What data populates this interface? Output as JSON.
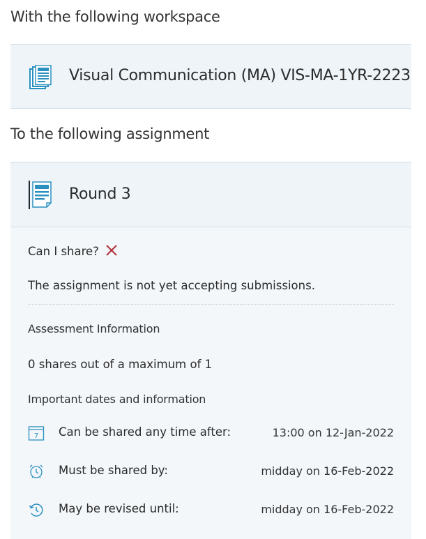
{
  "workspace": {
    "heading": "With the following workspace",
    "name": "Visual Communication (MA) VIS-MA-1YR-2223",
    "icon": "documents-icon"
  },
  "assignment": {
    "heading": "To the following assignment",
    "name": "Round 3",
    "icon": "document-icon"
  },
  "details": {
    "can_share_label": "Can I share?",
    "can_share_icon": "cross-icon",
    "status_message": "The assignment is not yet accepting submissions.",
    "assessment_heading": "Assessment Information",
    "shares_text": "0 shares out of a maximum of 1",
    "dates_heading": "Important dates and information",
    "dates": [
      {
        "icon": "calendar-icon",
        "label": "Can be shared any time after:",
        "value": "13:00 on 12-Jan-2022"
      },
      {
        "icon": "alarm-clock-icon",
        "label": "Must be shared by:",
        "value": "midday on 16-Feb-2022"
      },
      {
        "icon": "history-clock-icon",
        "label": "May be revised until:",
        "value": "midday on 16-Feb-2022"
      }
    ]
  },
  "colors": {
    "accent": "#2a90c0",
    "cross": "#b0303a",
    "card_bg": "#eef4f8"
  }
}
